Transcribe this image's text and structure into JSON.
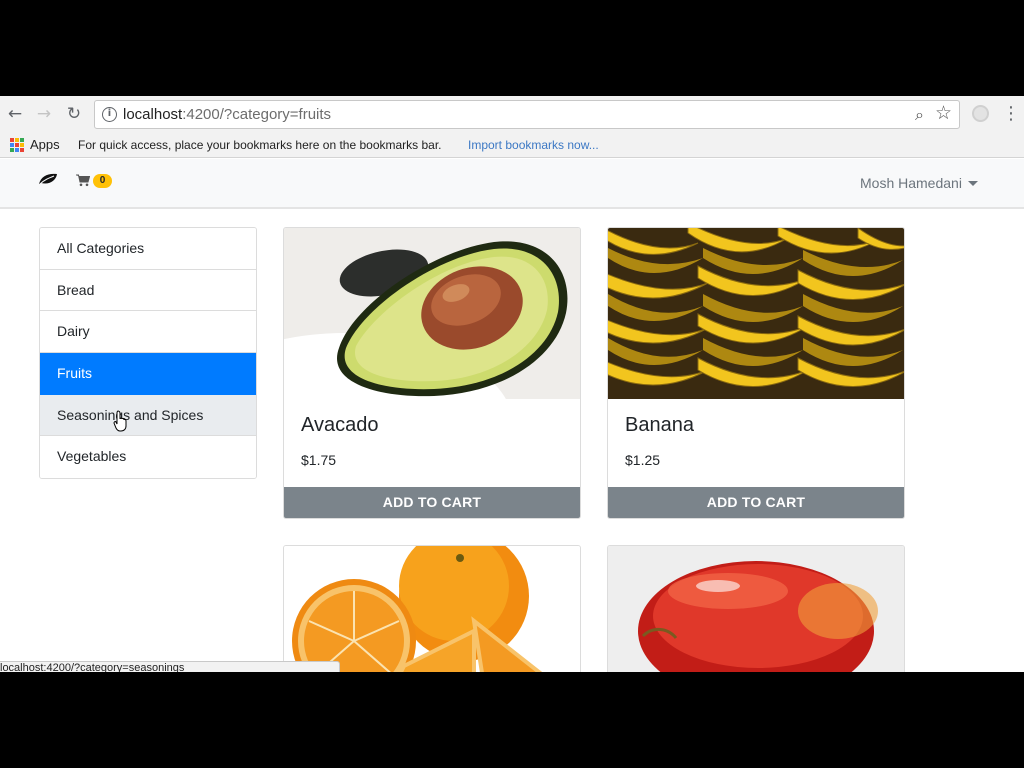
{
  "browser": {
    "url_host": "localhost",
    "url_rest": ":4200/?category=fruits",
    "back_glyph": "←",
    "forward_glyph": "→",
    "reload_glyph": "↻",
    "info_glyph": "i",
    "zoom_glyph": "⌕",
    "star_glyph": "☆",
    "menu_glyph": "⋮",
    "status_url": "localhost:4200/?category=seasonings"
  },
  "bookmarks": {
    "apps_label": "Apps",
    "hint": "For quick access, place your bookmarks here on the bookmarks bar.",
    "import_link": "Import bookmarks now..."
  },
  "navbar": {
    "brand_icon": "leaf-icon",
    "cart_icon": "shopping-cart-icon",
    "cart_count": "0",
    "user_name": "Mosh Hamedani",
    "accent_color": "#ffc107"
  },
  "categories": {
    "items": [
      {
        "label": "All Categories"
      },
      {
        "label": "Bread"
      },
      {
        "label": "Dairy"
      },
      {
        "label": "Fruits"
      },
      {
        "label": "Seasonings and Spices"
      },
      {
        "label": "Vegetables"
      }
    ],
    "active_color": "#007bff"
  },
  "products": [
    {
      "title": "Avacado",
      "price": "$1.75",
      "button": "ADD TO CART"
    },
    {
      "title": "Banana",
      "price": "$1.25",
      "button": "ADD TO CART"
    }
  ]
}
